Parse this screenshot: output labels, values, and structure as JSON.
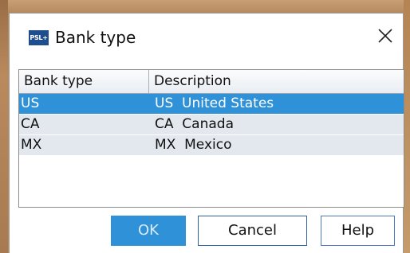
{
  "window": {
    "title": "Bank type",
    "icon_text": "PSL+"
  },
  "table": {
    "columns": [
      "Bank type",
      "Description"
    ],
    "rows": [
      {
        "bank_type": "US",
        "description": "US  United States",
        "selected": true
      },
      {
        "bank_type": "CA",
        "description": "CA  Canada",
        "selected": false
      },
      {
        "bank_type": "MX",
        "description": "MX  Mexico",
        "selected": false
      }
    ]
  },
  "buttons": {
    "ok": "OK",
    "cancel": "Cancel",
    "help": "Help"
  },
  "colors": {
    "selection": "#2f91d8",
    "row_background": "#e3e8ef",
    "icon_background": "#1f4e8f"
  }
}
